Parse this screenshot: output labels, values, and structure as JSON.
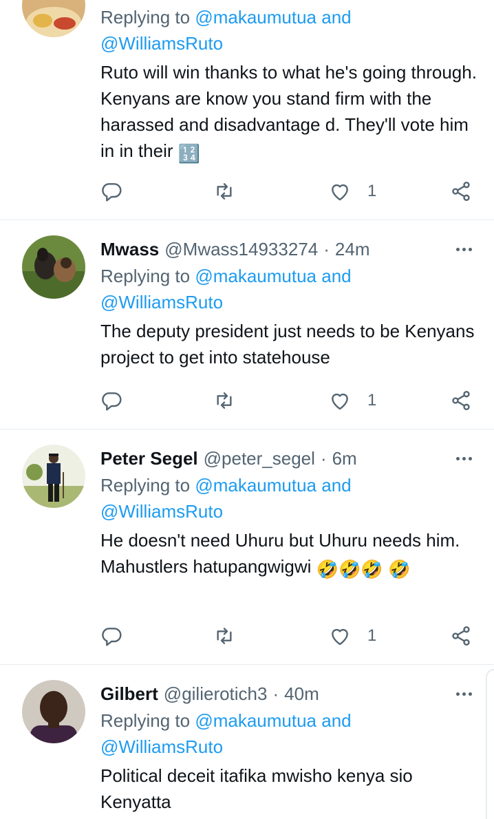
{
  "tweets": [
    {
      "reply_prefix": "Replying to",
      "reply_mention_1": "@makaumutua",
      "reply_and": "and",
      "reply_mention_2": "@WilliamsRuto",
      "text": "Ruto will win thanks to what he's going through. Kenyans are know you stand firm with the harassed and disadvantage d. They'll vote him in in their",
      "emoji": "🔢",
      "like_count": "1"
    },
    {
      "name": "Mwass",
      "handle": "@Mwass14933274",
      "dot": "·",
      "time": "24m",
      "reply_prefix": "Replying to",
      "reply_mention_1": "@makaumutua",
      "reply_and": "and",
      "reply_mention_2": "@WilliamsRuto",
      "text": "The deputy president just needs to be Kenyans project to get into statehouse",
      "like_count": "1"
    },
    {
      "name": "Peter Segel",
      "handle": "@peter_segel",
      "dot": "·",
      "time": "6m",
      "reply_prefix": "Replying to",
      "reply_mention_1": "@makaumutua",
      "reply_and": "and",
      "reply_mention_2": "@WilliamsRuto",
      "text": "He doesn't need Uhuru but Uhuru needs him. Mahustlers hatupangwigwi",
      "emoji": "🤣🤣🤣 🤣",
      "like_count": "1"
    },
    {
      "name": "Gilbert",
      "handle": "@gilierotich3",
      "dot": "·",
      "time": "40m",
      "reply_prefix": "Replying to",
      "reply_mention_1": "@makaumutua",
      "reply_and": "and",
      "reply_mention_2": "@WilliamsRuto",
      "text": "Political deceit itafika mwisho kenya sio Kenyatta"
    }
  ],
  "icons": {
    "reply": "reply-icon",
    "retweet": "retweet-icon",
    "like": "heart-icon",
    "share": "share-icon",
    "more": "more-icon"
  },
  "colors": {
    "link": "#1d9bf0",
    "muted": "#536471",
    "text": "#0f1419",
    "divider": "#e6ecf0"
  }
}
